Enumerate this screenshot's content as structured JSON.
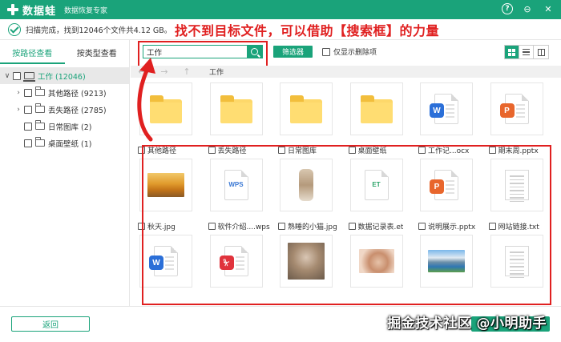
{
  "app": {
    "name": "数据蛙",
    "subtitle": "数据恢复专家",
    "help_icon": "?",
    "minimize_icon": "⊖",
    "close_icon": "✕"
  },
  "scan": {
    "status_text": "扫描完成，找到12046个文件共4.12 GB。"
  },
  "annotation": {
    "text": "找不到目标文件，可以借助【搜索框】的力量",
    "color": "#e02020"
  },
  "sidebar": {
    "tabs": [
      {
        "label": "按路径查看",
        "active": true
      },
      {
        "label": "按类型查看",
        "active": false
      }
    ],
    "tree": [
      {
        "caret": "∨",
        "label": "工作 (12046)",
        "icon": "drive-icon",
        "root": true
      },
      {
        "caret": "›",
        "label": "其他路径 (9213)",
        "icon": "folder-icon"
      },
      {
        "caret": "›",
        "label": "丢失路径 (2785)",
        "icon": "folder-icon"
      },
      {
        "caret": "",
        "label": "日常图库 (2)",
        "icon": "folder-icon"
      },
      {
        "caret": "",
        "label": "桌面壁纸 (1)",
        "icon": "folder-icon"
      }
    ]
  },
  "toolbar": {
    "search_value": "工作",
    "search_placeholder": "",
    "filter_label": "筛选器",
    "deleted_only_label": "仅显示删除项"
  },
  "pathbar": {
    "back": "←",
    "forward": "→",
    "up": "↑",
    "path": "工作"
  },
  "files": [
    {
      "name": "其他路径",
      "kind": "folder"
    },
    {
      "name": "丢失路径",
      "kind": "folder"
    },
    {
      "name": "日常图库",
      "kind": "folder"
    },
    {
      "name": "桌面壁纸",
      "kind": "folder"
    },
    {
      "name": "工作记...ocx",
      "kind": "word",
      "badge": "W"
    },
    {
      "name": "期末周.pptx",
      "kind": "ppt",
      "badge": "P"
    },
    {
      "name": "秋天.jpg",
      "kind": "photo-autumn"
    },
    {
      "name": "软件介绍....wps",
      "kind": "wps",
      "badge": "WPS"
    },
    {
      "name": "熟睡的小猫.jpg",
      "kind": "photo-cat"
    },
    {
      "name": "数据记录表.et",
      "kind": "et",
      "badge": "ET"
    },
    {
      "name": "说明展示.pptx",
      "kind": "ppt",
      "badge": "P"
    },
    {
      "name": "网站链接.txt",
      "kind": "txt"
    },
    {
      "name": "",
      "kind": "word",
      "badge": "W"
    },
    {
      "name": "",
      "kind": "pdf",
      "badge": "⏧"
    },
    {
      "name": "",
      "kind": "photo-kitten"
    },
    {
      "name": "",
      "kind": "photo-rabbit"
    },
    {
      "name": "",
      "kind": "photo-lake"
    },
    {
      "name": "",
      "kind": "txt"
    }
  ],
  "colors": {
    "brand": "#1aa37a",
    "word": "#2b6fd8",
    "ppt": "#e8662c",
    "pdf": "#e0333c",
    "wps": "#3a78d4",
    "et": "#2aa368"
  },
  "bottom": {
    "back_label": "返回",
    "watermark": "掘金技术社区 @小明助手"
  }
}
